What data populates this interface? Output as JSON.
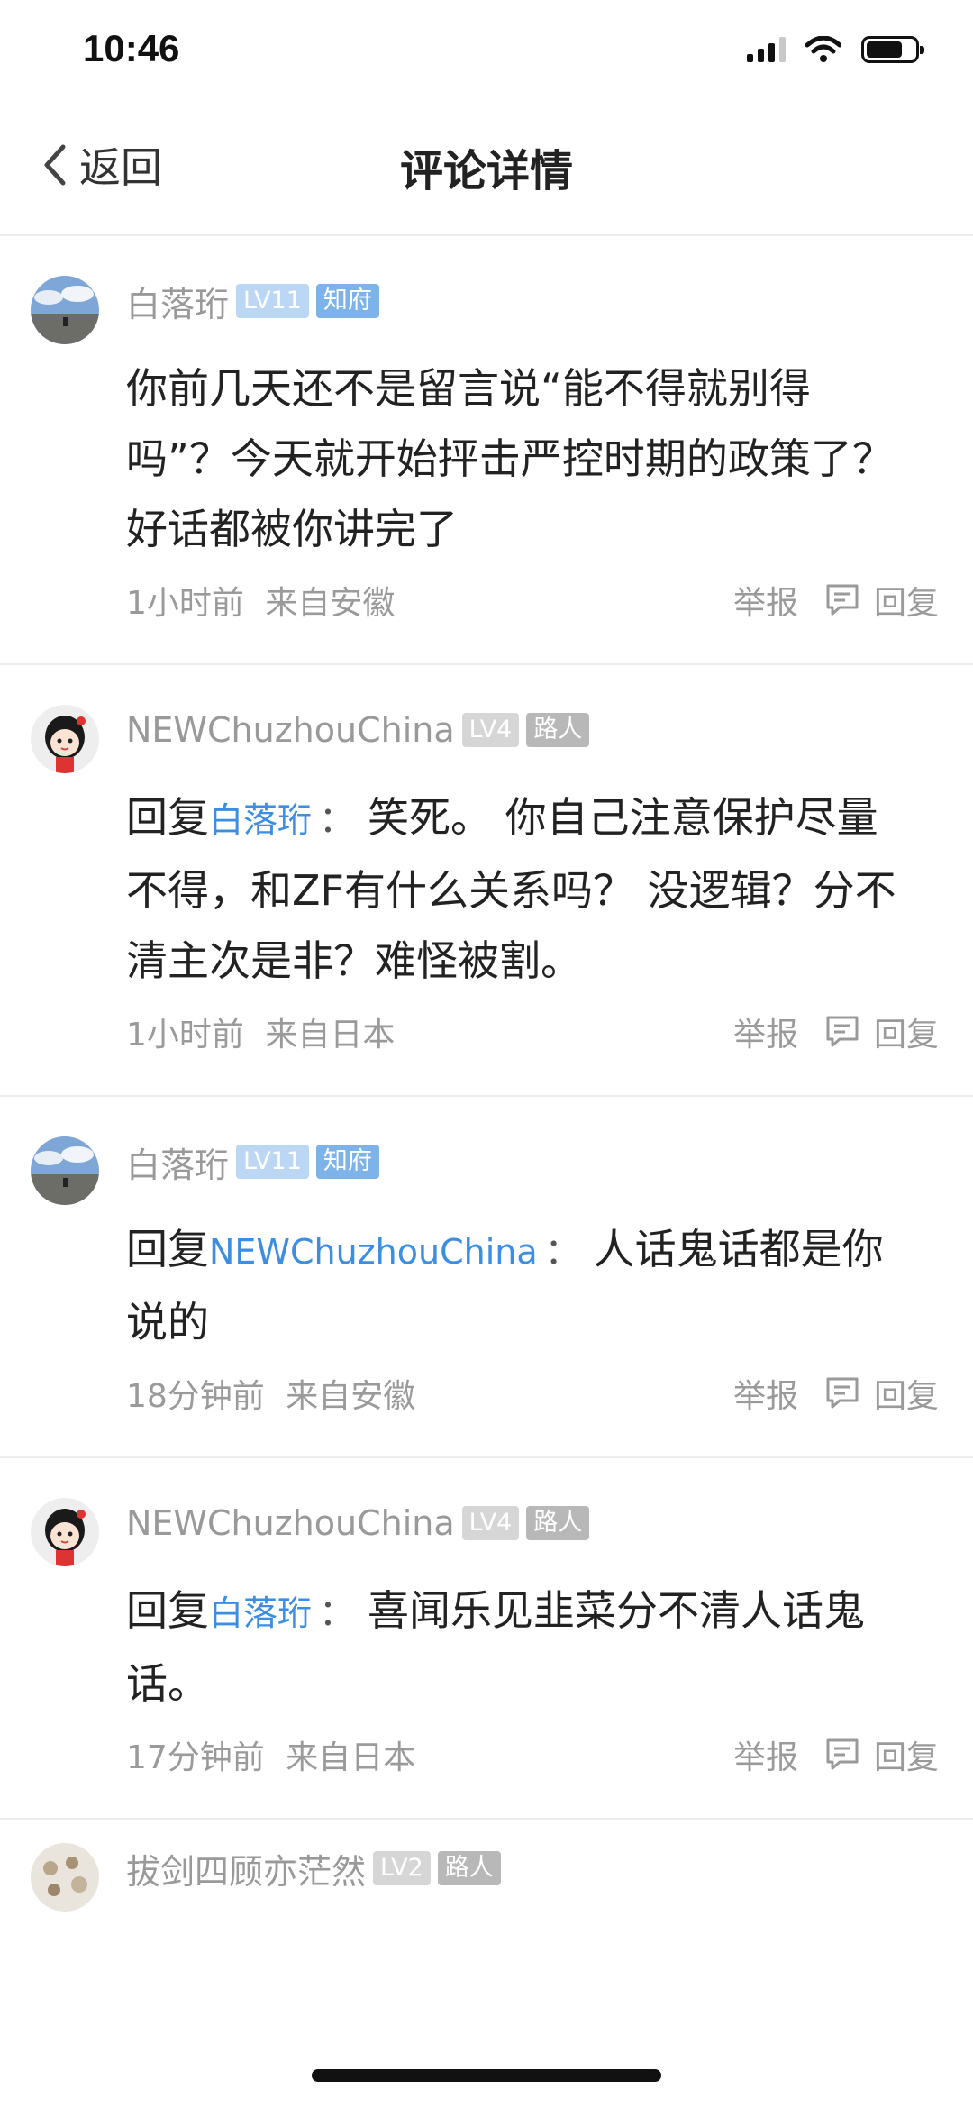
{
  "status": {
    "time": "10:46"
  },
  "nav": {
    "back_label": "返回",
    "title": "评论详情"
  },
  "comments": [
    {
      "user": "白落珩",
      "level": "LV11",
      "rank": "知府",
      "text": "你前几天还不是留言说“能不得就别得吗”？今天就开始抨击严控时期的政策了？好话都被你讲完了",
      "time": "1小时前",
      "location": "来自安徽",
      "report_label": "举报",
      "reply_label": "回复"
    },
    {
      "user": "NEWChuzhouChina",
      "level": "LV4",
      "rank": "路人",
      "reply_prefix": "回复",
      "mention": "白落珩",
      "mention_sep": "：",
      "text": "笑死。 你自己注意保护尽量不得，和ZF有什么关系吗？ 没逻辑？分不清主次是非？难怪被割。",
      "time": "1小时前",
      "location": "来自日本",
      "report_label": "举报",
      "reply_label": "回复"
    },
    {
      "user": "白落珩",
      "level": "LV11",
      "rank": "知府",
      "reply_prefix": "回复",
      "mention": "NEWChuzhouChina",
      "mention_sep": "：",
      "text": "人话鬼话都是你说的",
      "time": "18分钟前",
      "location": "来自安徽",
      "report_label": "举报",
      "reply_label": "回复"
    },
    {
      "user": "NEWChuzhouChina",
      "level": "LV4",
      "rank": "路人",
      "reply_prefix": "回复",
      "mention": "白落珩",
      "mention_sep": "：",
      "text": "喜闻乐见韭菜分不清人话鬼话。",
      "time": "17分钟前",
      "location": "来自日本",
      "report_label": "举报",
      "reply_label": "回复"
    },
    {
      "user": "拔剑四顾亦茫然",
      "level": "LV2",
      "rank": "路人"
    }
  ],
  "colors": {
    "mention": "#3b8ee2",
    "meta": "#9a9a9a",
    "badge_blue": "#7eb3ea",
    "badge_grey": "#b8b8b8"
  }
}
